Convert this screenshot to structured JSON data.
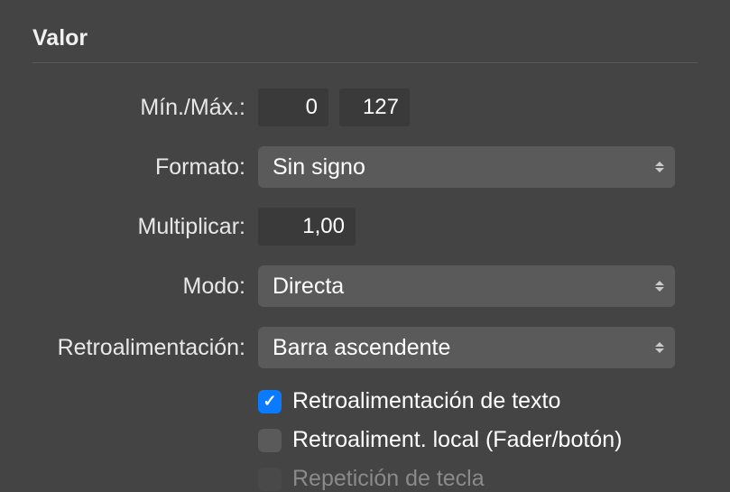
{
  "section": {
    "title": "Valor"
  },
  "minmax": {
    "label": "Mín./Máx.:",
    "min": "0",
    "max": "127"
  },
  "formato": {
    "label": "Formato:",
    "value": "Sin signo"
  },
  "multiplicar": {
    "label": "Multiplicar:",
    "value": "1,00"
  },
  "modo": {
    "label": "Modo:",
    "value": "Directa"
  },
  "retro": {
    "label": "Retroalimentación:",
    "value": "Barra ascendente"
  },
  "checkboxes": {
    "texto": "Retroalimentación de texto",
    "local": "Retroaliment. local (Fader/botón)",
    "repeticion": "Repetición de tecla"
  }
}
